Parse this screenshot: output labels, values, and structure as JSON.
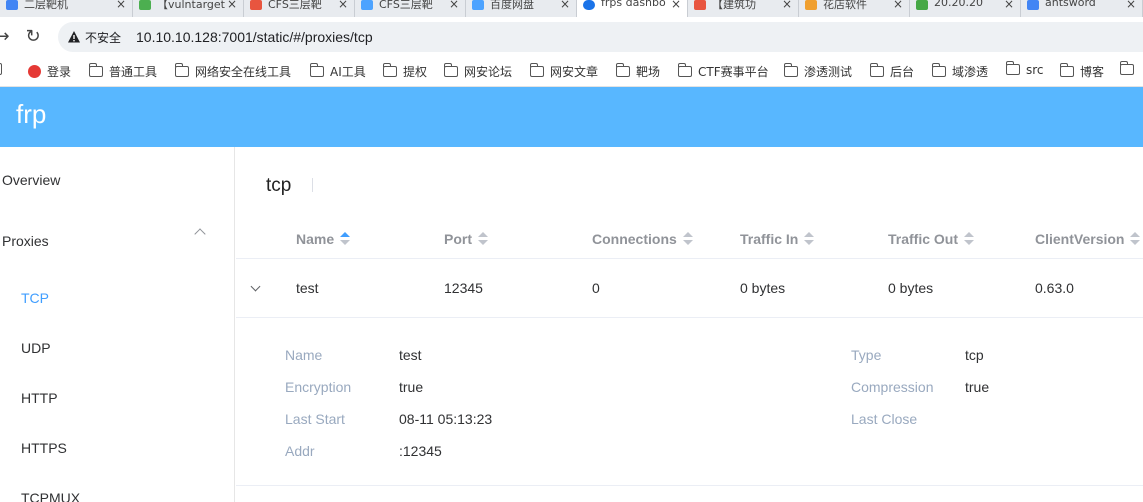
{
  "browser": {
    "tabs": [
      {
        "title": "二层靶机",
        "fav": "#4285f4"
      },
      {
        "title": "【vulntarget",
        "fav": "#4caf50"
      },
      {
        "title": "CFS三层靶",
        "fav": "#e8553f"
      },
      {
        "title": "CFS三层靶",
        "fav": "#4da3ff"
      },
      {
        "title": "百度网盘",
        "fav": "#4da3ff"
      },
      {
        "title": "frps dashbo",
        "fav": "#1a73e8"
      },
      {
        "title": "【建筑功",
        "fav": "#e8553f"
      },
      {
        "title": "花店软件",
        "fav": "#f0a030"
      },
      {
        "title": "20.20.20",
        "fav": "#46a846"
      },
      {
        "title": "antsword",
        "fav": "#4285f4"
      }
    ],
    "insecure_label": "不安全",
    "url": "10.10.10.128:7001/static/#/proxies/tcp",
    "bookmarks": [
      "登录",
      "普通工具",
      "网络安全在线工具",
      "AI工具",
      "提权",
      "网安论坛",
      "网安文章",
      "靶场",
      "CTF赛事平台",
      "渗透测试",
      "后台",
      "域渗透",
      "src",
      "博客"
    ]
  },
  "app": {
    "brand": "frp"
  },
  "sidebar": {
    "overview": "Overview",
    "proxies": "Proxies",
    "sub_items": [
      "TCP",
      "UDP",
      "HTTP",
      "HTTPS",
      "TCPMUX"
    ]
  },
  "main": {
    "title": "tcp",
    "columns": [
      "Name",
      "Port",
      "Connections",
      "Traffic In",
      "Traffic Out",
      "ClientVersion"
    ],
    "rows": [
      {
        "name": "test",
        "port": "12345",
        "connections": "0",
        "traffic_in": "0 bytes",
        "traffic_out": "0 bytes",
        "client_version": "0.63.0"
      }
    ],
    "detail": {
      "name_label": "Name",
      "name": "test",
      "encryption_label": "Encryption",
      "encryption": "true",
      "last_start_label": "Last Start",
      "last_start": "08-11 05:13:23",
      "addr_label": "Addr",
      "addr": ":12345",
      "type_label": "Type",
      "type": "tcp",
      "compression_label": "Compression",
      "compression": "true",
      "last_close_label": "Last Close"
    }
  },
  "colors": {
    "header": "#58b7ff",
    "accent": "#409eff",
    "muted_label": "#99a9bf"
  }
}
